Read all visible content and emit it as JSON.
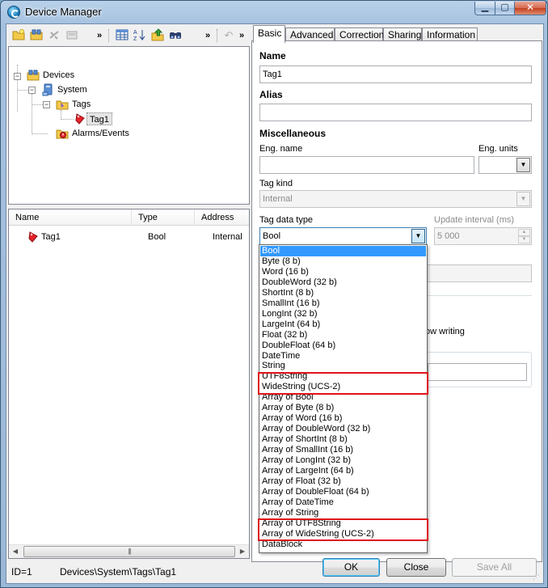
{
  "window": {
    "title": "Device Manager",
    "min_glyph": "▁",
    "max_glyph": "▢",
    "close_glyph": "✕"
  },
  "toolbar": {
    "overflow1": "»",
    "overflow2": "»",
    "overflow3": "»"
  },
  "tree": {
    "devices": "Devices",
    "system": "System",
    "tags": "Tags",
    "tag1": "Tag1",
    "alarms": "Alarms/Events"
  },
  "list": {
    "columns": [
      "Name",
      "Type",
      "Address"
    ],
    "rows": [
      {
        "name": "Tag1",
        "type": "Bool",
        "address": "Internal"
      }
    ]
  },
  "status": {
    "id": "ID=1",
    "path": "Devices\\System\\Tags\\Tag1"
  },
  "tabs": [
    "Basic",
    "Advanced",
    "Correction",
    "Sharing",
    "Information"
  ],
  "form": {
    "name_label": "Name",
    "name_value": "Tag1",
    "alias_label": "Alias",
    "alias_value": "",
    "misc_label": "Miscellaneous",
    "eng_name_label": "Eng. name",
    "eng_name_value": "",
    "eng_units_label": "Eng. units",
    "eng_units_value": "",
    "tag_kind_label": "Tag kind",
    "tag_kind_value": "Internal",
    "data_type_label": "Tag data type",
    "data_type_value": "Bool",
    "update_label": "Update interval (ms)",
    "update_value": "5 000",
    "allow_writing_partial": "ow writing"
  },
  "dropdown": {
    "items": [
      "Bool",
      "Byte (8 b)",
      "Word (16 b)",
      "DoubleWord (32 b)",
      "ShortInt (8 b)",
      "SmallInt (16 b)",
      "LongInt (32 b)",
      "LargeInt (64 b)",
      "Float (32 b)",
      "DoubleFloat (64 b)",
      "DateTime",
      "String",
      "UTF8String",
      "WideString (UCS-2)",
      "Array of Bool",
      "Array of Byte (8 b)",
      "Array of Word (16 b)",
      "Array of DoubleWord (32 b)",
      "Array of ShortInt (8 b)",
      "Array of SmallInt (16 b)",
      "Array of LongInt (32 b)",
      "Array of LargeInt (64 b)",
      "Array of Float (32 b)",
      "Array of DoubleFloat (64 b)",
      "Array of DateTime",
      "Array of String",
      "Array of UTF8String",
      "Array of WideString (UCS-2)",
      "DataBlock"
    ],
    "selected": "Bool"
  },
  "buttons": {
    "ok": "OK",
    "close": "Close",
    "save_all": "Save All"
  },
  "colors": {
    "selection": "#3399ff",
    "highlight_box": "#e0141a"
  }
}
